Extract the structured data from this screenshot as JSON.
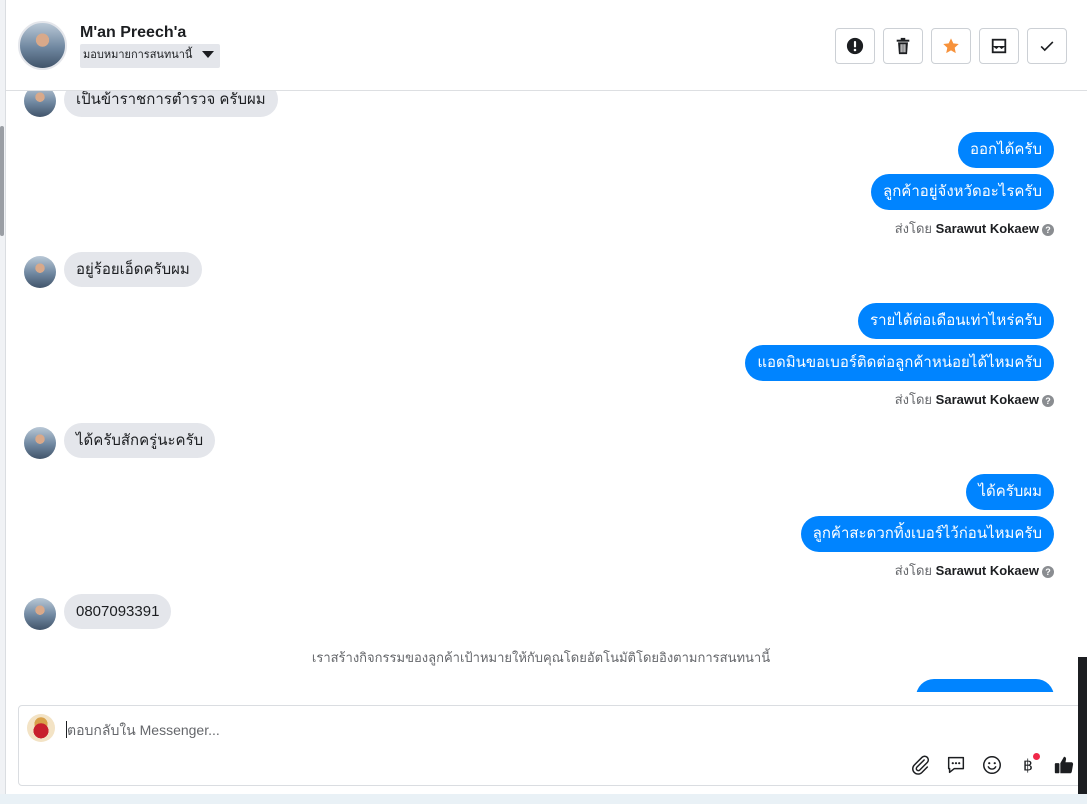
{
  "header": {
    "contact_name": "M'an Preech'a",
    "assign_label": "มอบหมายการสนทนานี้",
    "actions": [
      {
        "name": "spam-button",
        "icon": "exclamation-circle-icon"
      },
      {
        "name": "delete-button",
        "icon": "trash-icon"
      },
      {
        "name": "star-button",
        "icon": "star-icon",
        "color": "#f7923b"
      },
      {
        "name": "mark-unread-button",
        "icon": "envelope-icon"
      },
      {
        "name": "mark-done-button",
        "icon": "check-icon"
      }
    ]
  },
  "thread": {
    "messages_in": [
      "เป็นข้าราชการตำรวจ ครับผม",
      "อยู่ร้อยเอ็ดครับผม",
      "ได้ครับสักครู่นะครับ",
      "0807093391"
    ],
    "messages_out": [
      "ออกได้ครับ",
      "ลูกค้าอยู่จังหวัดอะไรครับ",
      "รายได้ต่อเดือนเท่าไหร่ครับ",
      "แอดมินขอเบอร์ติดต่อลูกค้าหน่อยได้ไหมครับ",
      "ได้ครับผม",
      "ลูกค้าสะดวกทิ้งเบอร์ไว้ก่อนไหมครับ"
    ],
    "sent_by_prefix": "ส่งโดย",
    "sent_by_name": "Sarawut Kokaew",
    "system_note": "เราสร้างกิจกรรมของลูกค้าเป้าหมายให้กับคุณโดยอัตโนมัติโดยอิงตามการสนทนานี้"
  },
  "composer": {
    "placeholder": "ตอบกลับใน Messenger...",
    "tools": [
      "paperclip-icon",
      "saved-reply-icon",
      "emoji-icon",
      "baht-payment-icon",
      "thumbs-up-icon"
    ],
    "accent_color": "#0084ff",
    "badge_color": "#f02849"
  }
}
